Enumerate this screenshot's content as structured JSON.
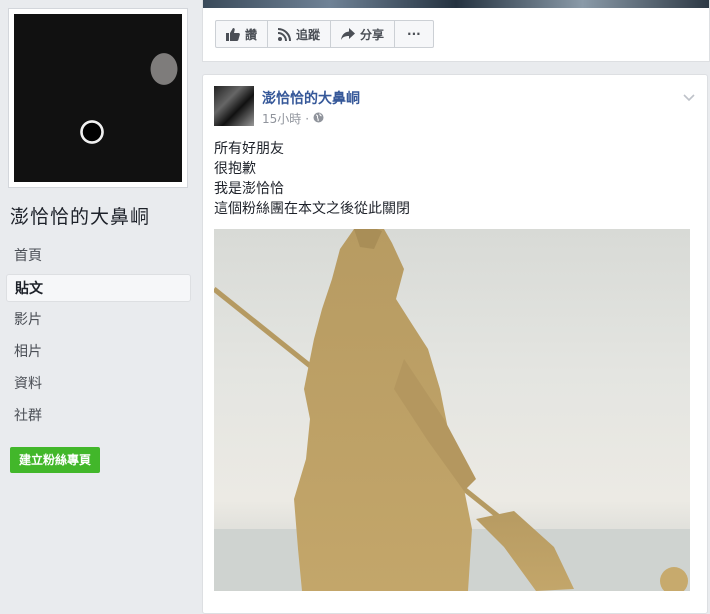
{
  "page": {
    "name": "澎恰恰的大鼻峒",
    "create_page_label": "建立粉絲專頁"
  },
  "nav": {
    "items": [
      {
        "label": "首頁"
      },
      {
        "label": "貼文"
      },
      {
        "label": "影片"
      },
      {
        "label": "相片"
      },
      {
        "label": "資料"
      },
      {
        "label": "社群"
      }
    ],
    "active": "貼文"
  },
  "actions": {
    "like_label": "讚",
    "follow_label": "追蹤",
    "share_label": "分享",
    "more_label": "···"
  },
  "post": {
    "author": "澎恰恰的大鼻峒",
    "time": "15小時",
    "separator": "·",
    "privacy_icon": "globe-icon",
    "lines": [
      "所有好朋友",
      "很抱歉",
      "我是澎恰恰",
      "這個粉絲團在本文之後從此關閉"
    ]
  },
  "colors": {
    "background": "#e9ebee",
    "link": "#365899",
    "green_button": "#42b72a",
    "statue": "#b89a5c"
  }
}
